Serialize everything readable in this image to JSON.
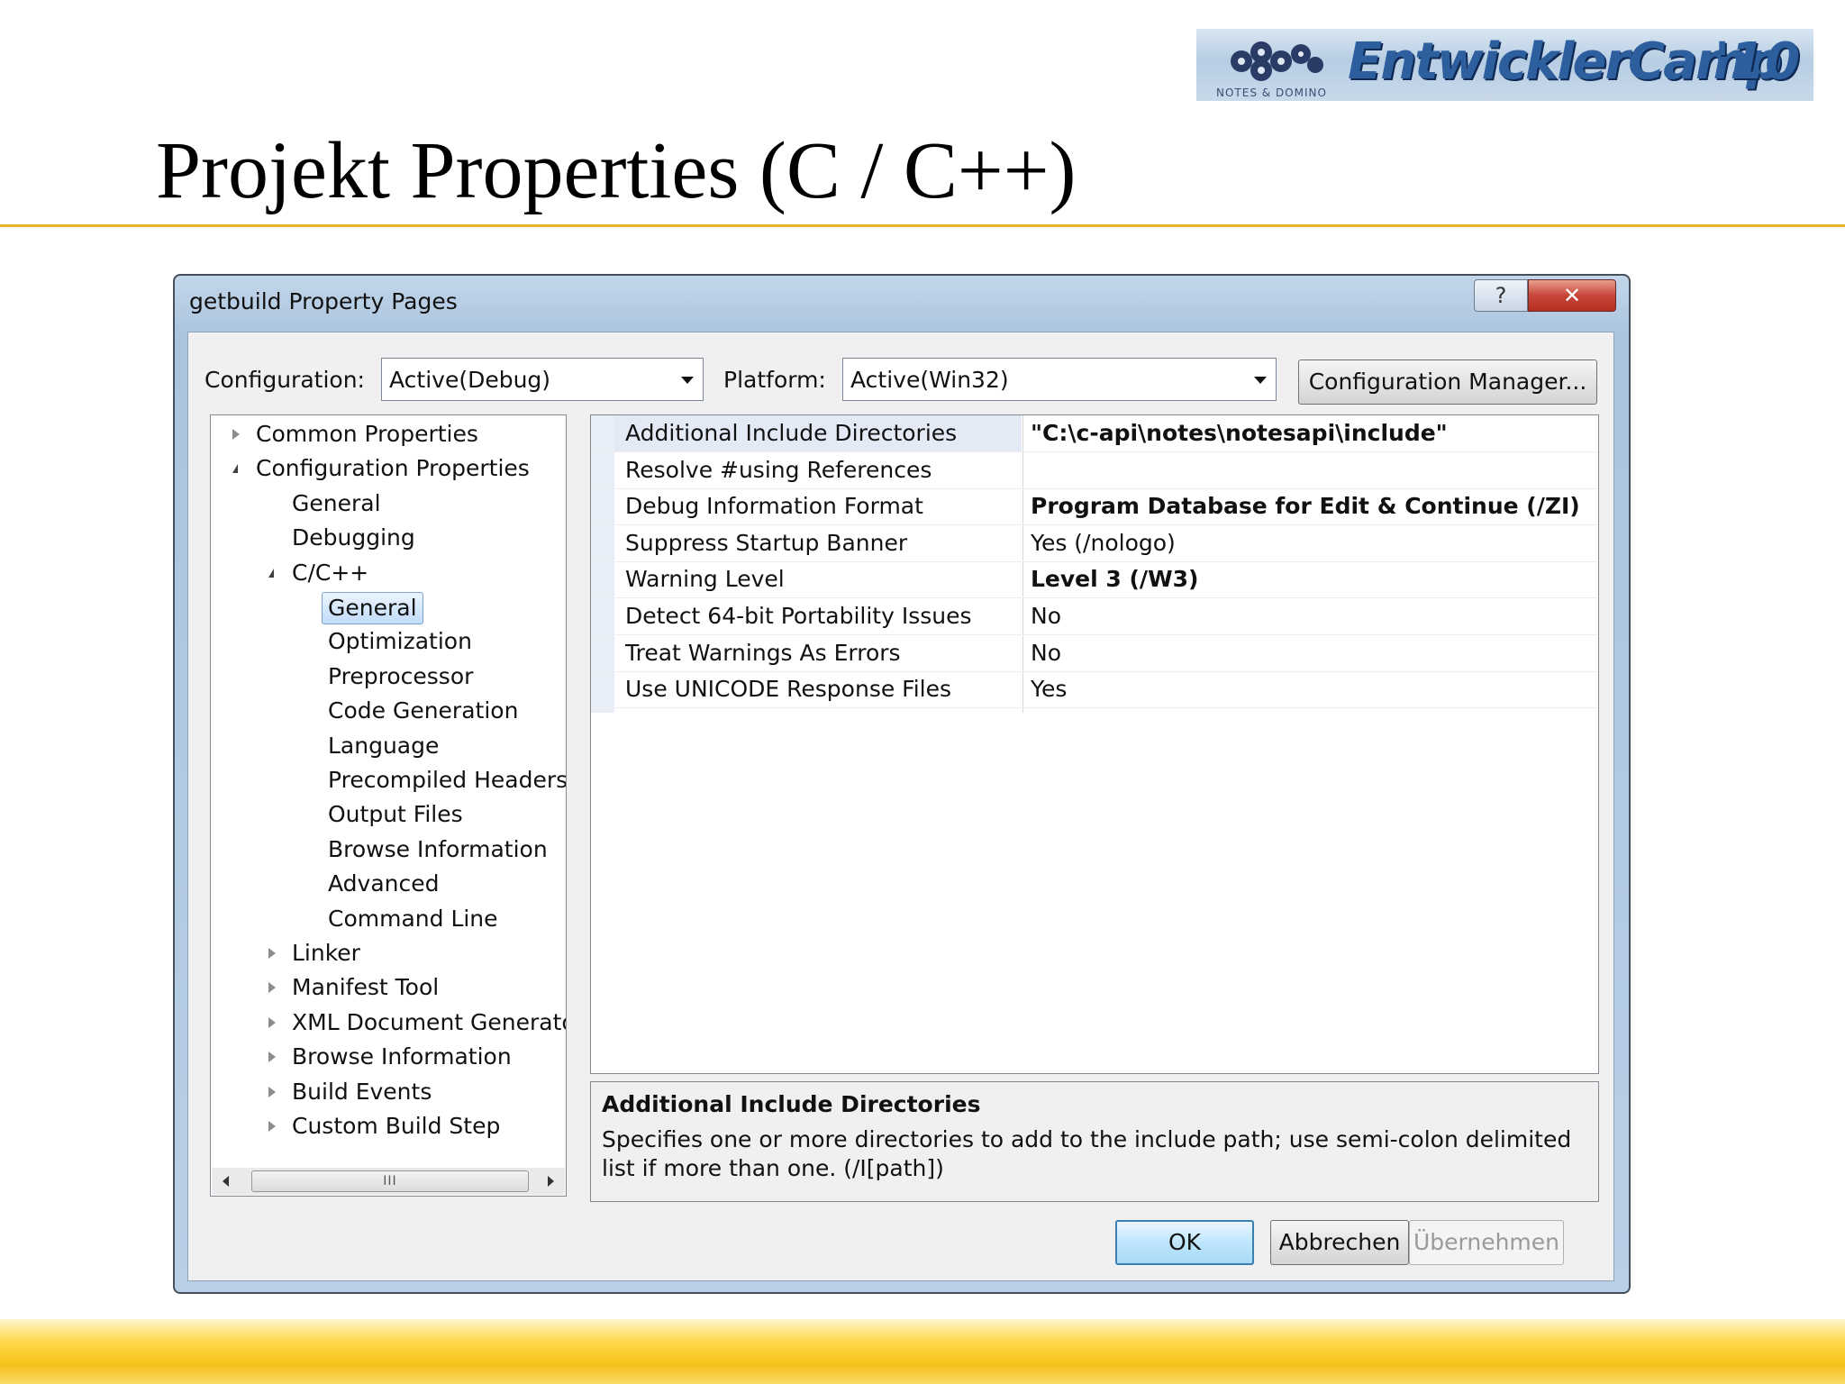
{
  "slide": {
    "title": "Projekt Properties (C / C++)",
    "logo_text": "EntwicklerCamp",
    "logo_year": "'10",
    "logo_subtext": "NOTES & DOMINO"
  },
  "window": {
    "title": "getbuild Property Pages",
    "help_label": "?",
    "close_label": "✕"
  },
  "config": {
    "configuration_label": "Configuration:",
    "configuration_value": "Active(Debug)",
    "platform_label": "Platform:",
    "platform_value": "Active(Win32)",
    "manager_button": "Configuration Manager..."
  },
  "tree": {
    "items": [
      {
        "label": "Common Properties",
        "expander": "closed"
      },
      {
        "label": "Configuration Properties",
        "expander": "open"
      },
      {
        "label": "General",
        "expander": "none"
      },
      {
        "label": "Debugging",
        "expander": "none"
      },
      {
        "label": "C/C++",
        "expander": "open"
      },
      {
        "label": "General",
        "expander": "none",
        "selected": true
      },
      {
        "label": "Optimization",
        "expander": "none"
      },
      {
        "label": "Preprocessor",
        "expander": "none"
      },
      {
        "label": "Code Generation",
        "expander": "none"
      },
      {
        "label": "Language",
        "expander": "none"
      },
      {
        "label": "Precompiled Headers",
        "expander": "none"
      },
      {
        "label": "Output Files",
        "expander": "none"
      },
      {
        "label": "Browse Information",
        "expander": "none"
      },
      {
        "label": "Advanced",
        "expander": "none"
      },
      {
        "label": "Command Line",
        "expander": "none"
      },
      {
        "label": "Linker",
        "expander": "closed"
      },
      {
        "label": "Manifest Tool",
        "expander": "closed"
      },
      {
        "label": "XML Document Generator",
        "expander": "closed"
      },
      {
        "label": "Browse Information",
        "expander": "closed"
      },
      {
        "label": "Build Events",
        "expander": "closed"
      },
      {
        "label": "Custom Build Step",
        "expander": "closed"
      }
    ],
    "scroll_thumb_label": "III"
  },
  "properties": [
    {
      "name": "Additional Include Directories",
      "value": "\"C:\\c-api\\notes\\notesapi\\include\"",
      "bold": true,
      "selected": true
    },
    {
      "name": "Resolve #using References",
      "value": "",
      "bold": false
    },
    {
      "name": "Debug Information Format",
      "value": "Program Database for Edit & Continue (/ZI)",
      "bold": true
    },
    {
      "name": "Suppress Startup Banner",
      "value": "Yes (/nologo)",
      "bold": false
    },
    {
      "name": "Warning Level",
      "value": "Level 3 (/W3)",
      "bold": true
    },
    {
      "name": "Detect 64-bit Portability Issues",
      "value": "No",
      "bold": false
    },
    {
      "name": "Treat Warnings As Errors",
      "value": "No",
      "bold": false
    },
    {
      "name": "Use UNICODE Response Files",
      "value": "Yes",
      "bold": false
    }
  ],
  "description": {
    "title": "Additional Include Directories",
    "body": "Specifies one or more directories to add to the include path; use semi-colon delimited list if more than one.     (/I[path])"
  },
  "buttons": {
    "ok": "OK",
    "cancel": "Abbrechen",
    "apply": "Übernehmen"
  },
  "colors": {
    "accent_rule": "#e6b422",
    "footer_band": "#f6c21a",
    "window_frame": "#aac4de",
    "close_button": "#c8463a"
  }
}
